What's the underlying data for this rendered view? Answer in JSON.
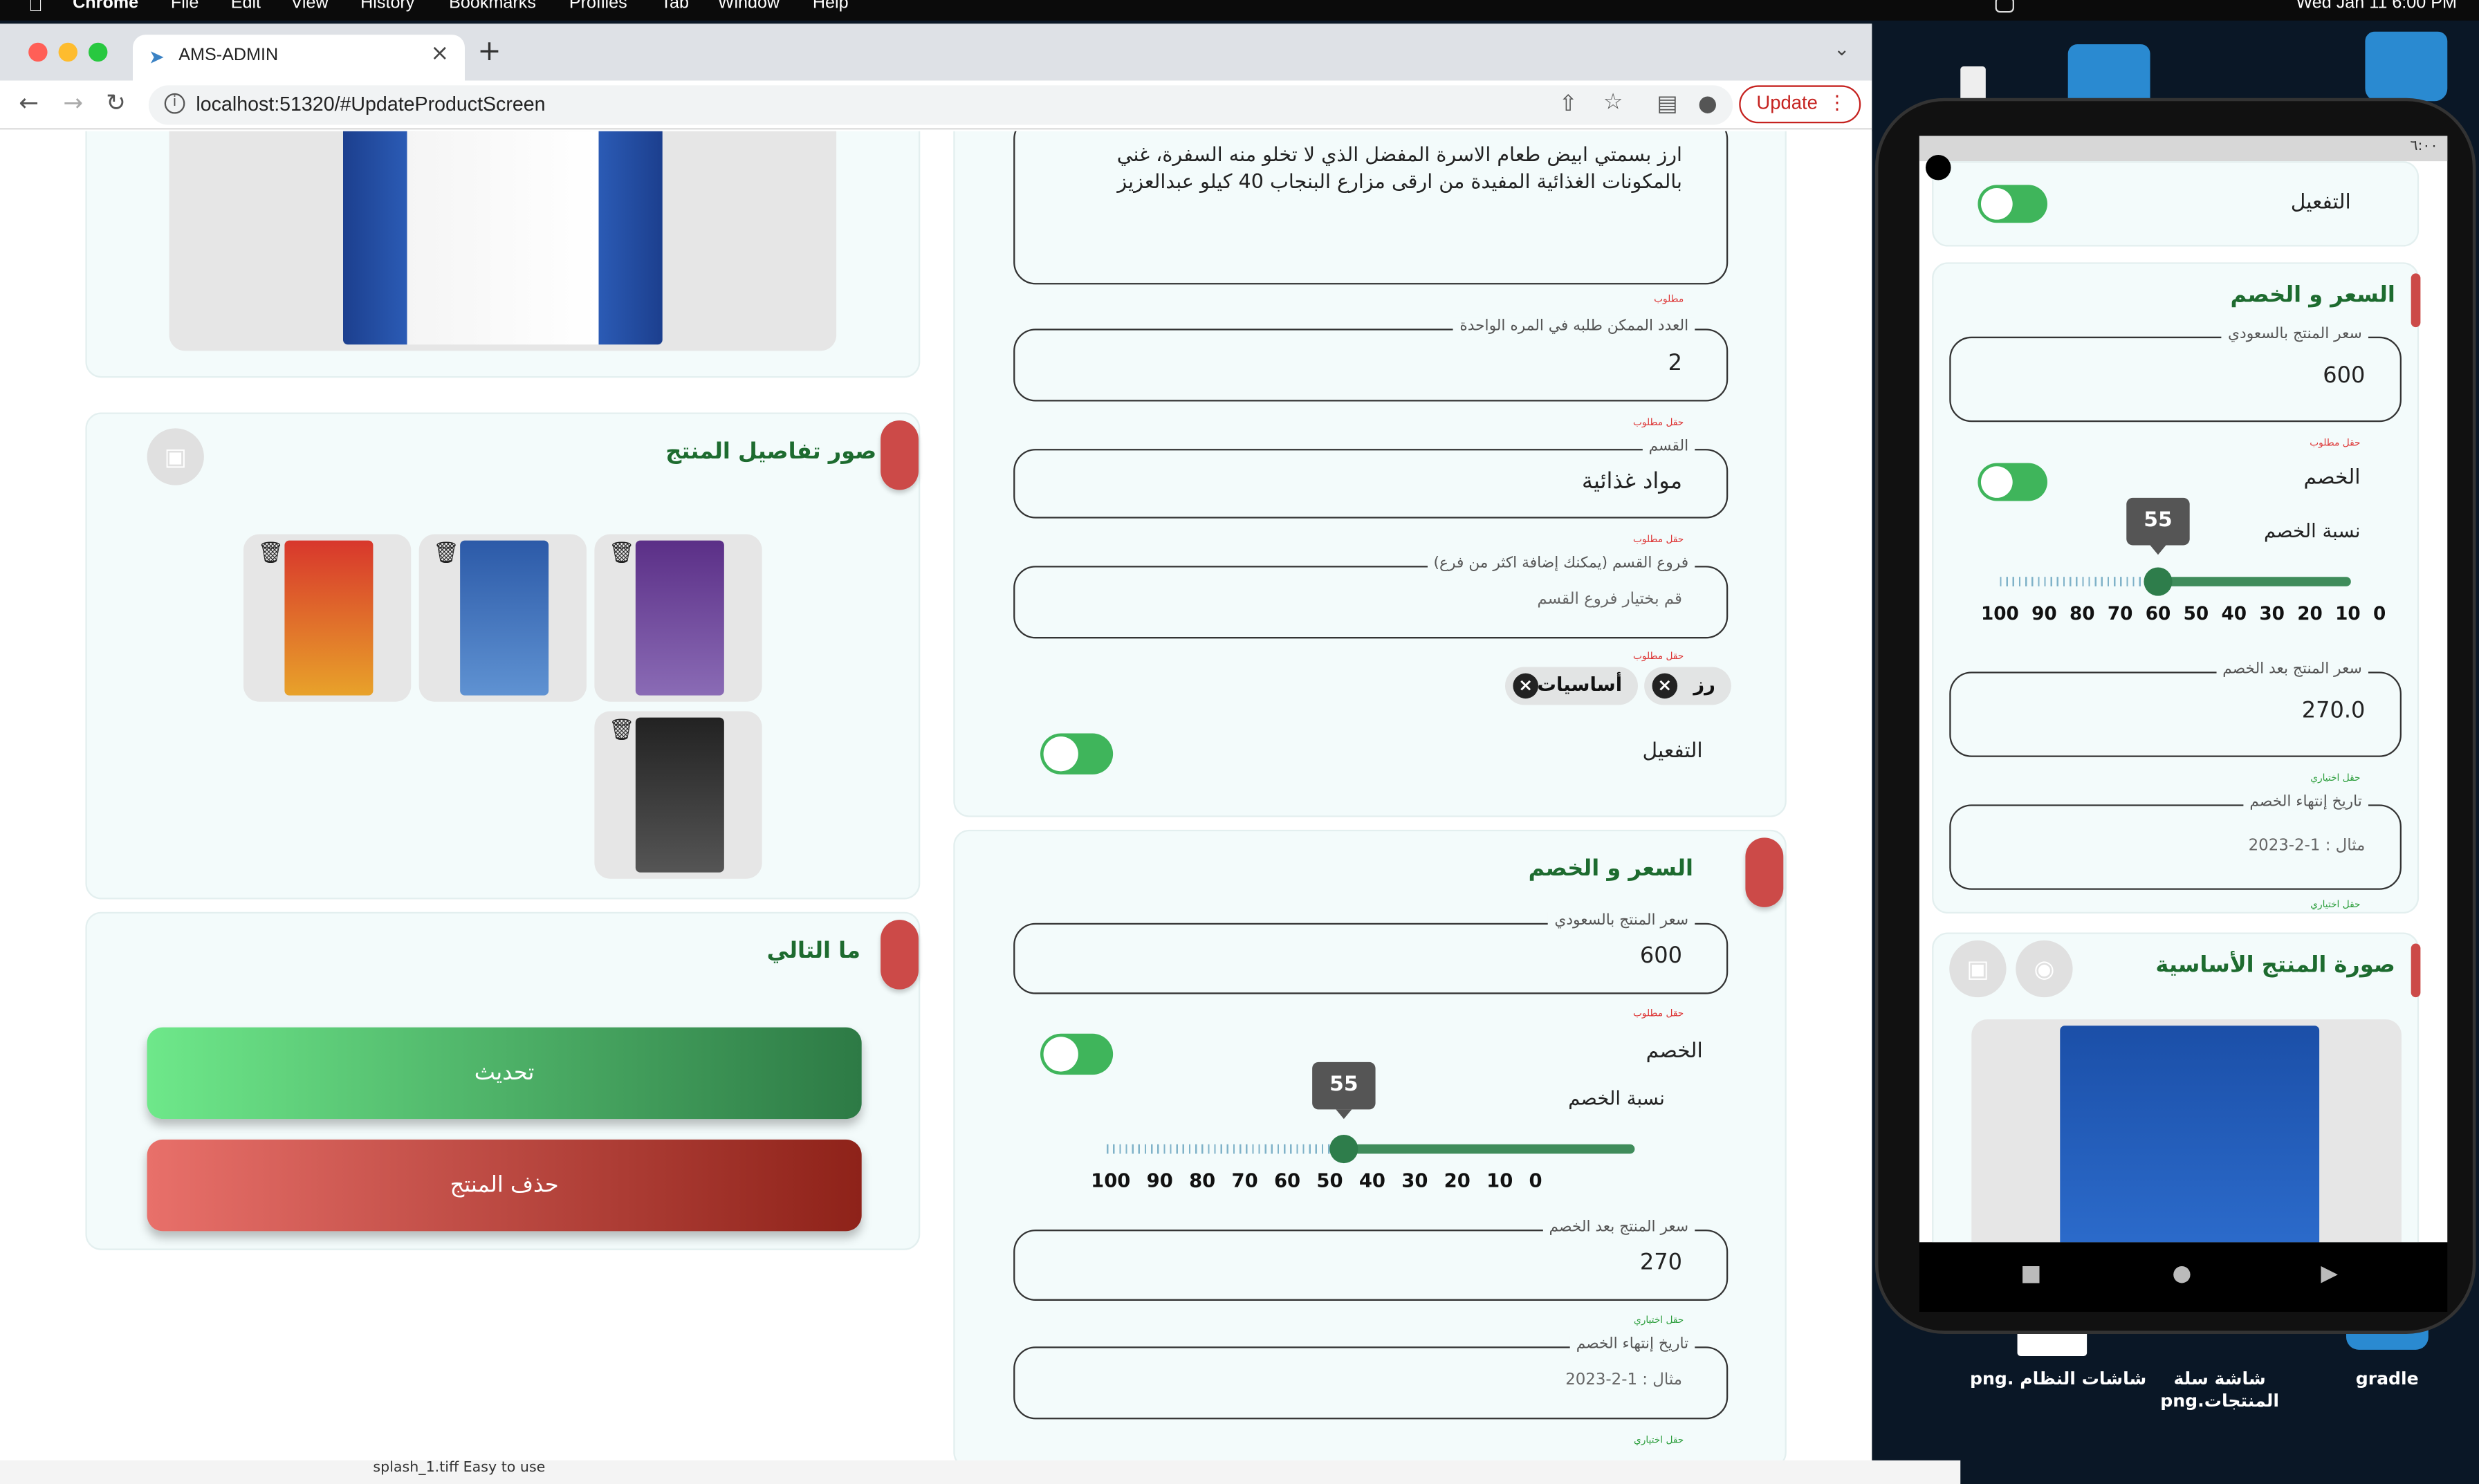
{
  "menubar": {
    "apple": "",
    "app_name": "Chrome",
    "items": [
      "File",
      "Edit",
      "View",
      "History",
      "Bookmarks",
      "Profiles",
      "Tab",
      "Window",
      "Help"
    ],
    "clock": "Wed Jan 11  6:00 PM"
  },
  "browser": {
    "tab_title": "AMS-ADMIN",
    "url": "localhost:51320/#UpdateProductScreen",
    "update_label": "Update"
  },
  "main_image_card": {},
  "detail_images": {
    "title": "صور تفاصيل المنتج"
  },
  "whats_next": {
    "title": "ما التالي",
    "update_button": "تحديث",
    "delete_button": "حذف المنتج"
  },
  "info_card": {
    "description": "ارز بسمتي ابيض طعام الاسرة المفضل الذي لا تخلو منه السفرة، غني بالمكونات الغذائية المفيدة من ارقى مزارع البنجاب 40 كيلو عبدالعزيز",
    "required_1": "مطلوب",
    "qty_label": "العدد الممكن طلبه في المره الواحدة",
    "qty_value": "2",
    "required_2": "حقل مطلوب",
    "category_label": "القسم",
    "category_value": "مواد غذائية",
    "required_3": "حقل مطلوب",
    "subcat_label": "فروع القسم (يمكنك إضافة اكثر من فرع)",
    "subcat_placeholder": "قم بختيار فروع القسم",
    "required_4": "حقل مطلوب",
    "chips": [
      "رز",
      "أساسيات"
    ],
    "activation_label": "التفعيل"
  },
  "price_card": {
    "title": "السعر و الخصم",
    "price_label": "سعر المنتج بالسعودي",
    "price_value": "600",
    "required": "حقل مطلوب",
    "discount_label": "الخصم",
    "discount_pct_label": "نسبة الخصم",
    "discount_value": "55",
    "scale": "100 90 80 70 60 50 40 30 20 10 0",
    "after_label": "سعر المنتج بعد الخصم",
    "after_value": "270",
    "optional_1": "حقل اختياري",
    "expiry_label": "تاريخ إنتهاء الخصم",
    "expiry_placeholder": "مثال : 1-2-2023",
    "optional_2": "حقل اختياري"
  },
  "phone": {
    "time": "٦:٠٠",
    "activation_label": "التفعيل",
    "price_title": "السعر و الخصم",
    "price_label": "سعر المنتج بالسعودي",
    "price_value": "600",
    "required": "حقل مطلوب",
    "discount_label": "الخصم",
    "discount_pct_label": "نسبة الخصم",
    "discount_value": "55",
    "scale": "100 90 80 70 60 50 40 30 20 10 0",
    "after_label": "سعر المنتج بعد الخصم",
    "after_value": "270.0",
    "optional_1": "حقل اختياري",
    "expiry_label": "تاريخ إنتهاء الخصم",
    "expiry_placeholder": "مثال : 1-2-2023",
    "optional_2": "حقل اختياري",
    "main_image_title": "صورة المنتج الأساسية"
  },
  "desktop": {
    "file1": "شاشات النظام .png",
    "file2": "شاشة سلة المنتجات.png",
    "file3": "gradle",
    "bottom_text": "splash_1.tiff     Easy to use"
  },
  "colors": {
    "accent_green": "#1d6b2f",
    "toggle_green": "#3fb55b",
    "pill_red": "#cc4a48",
    "card_bg": "#f3fbfb"
  }
}
